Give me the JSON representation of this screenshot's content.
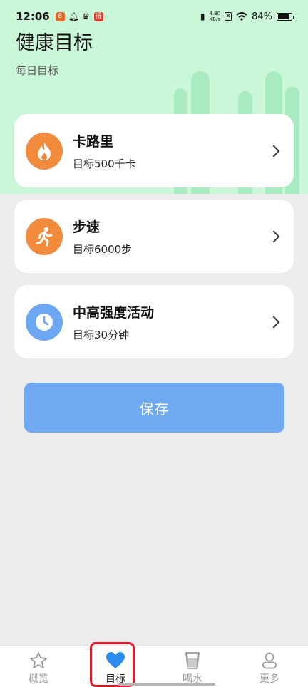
{
  "status": {
    "time": "12:06",
    "net_speed_top": "4.80",
    "net_speed_unit": "KB/s",
    "battery": "84%"
  },
  "header": {
    "title": "健康目标",
    "subtitle": "每日目标"
  },
  "goals": [
    {
      "name": "卡路里",
      "target": "目标500千卡",
      "icon": "fire-icon",
      "color": "#f28a3c"
    },
    {
      "name": "步速",
      "target": "目标6000步",
      "icon": "running-icon",
      "color": "#f28a3c"
    },
    {
      "name": "中高强度活动",
      "target": "目标30分钟",
      "icon": "clock-icon",
      "color": "#6ca7f1"
    }
  ],
  "save_label": "保存",
  "nav": [
    {
      "label": "概览",
      "icon": "star-icon"
    },
    {
      "label": "目标",
      "icon": "heart-icon"
    },
    {
      "label": "喝水",
      "icon": "cup-icon"
    },
    {
      "label": "更多",
      "icon": "person-icon"
    }
  ],
  "colors": {
    "header_bg": "#c9f7d8",
    "accent": "#6fa9f2",
    "highlight": "#e11b2a"
  }
}
